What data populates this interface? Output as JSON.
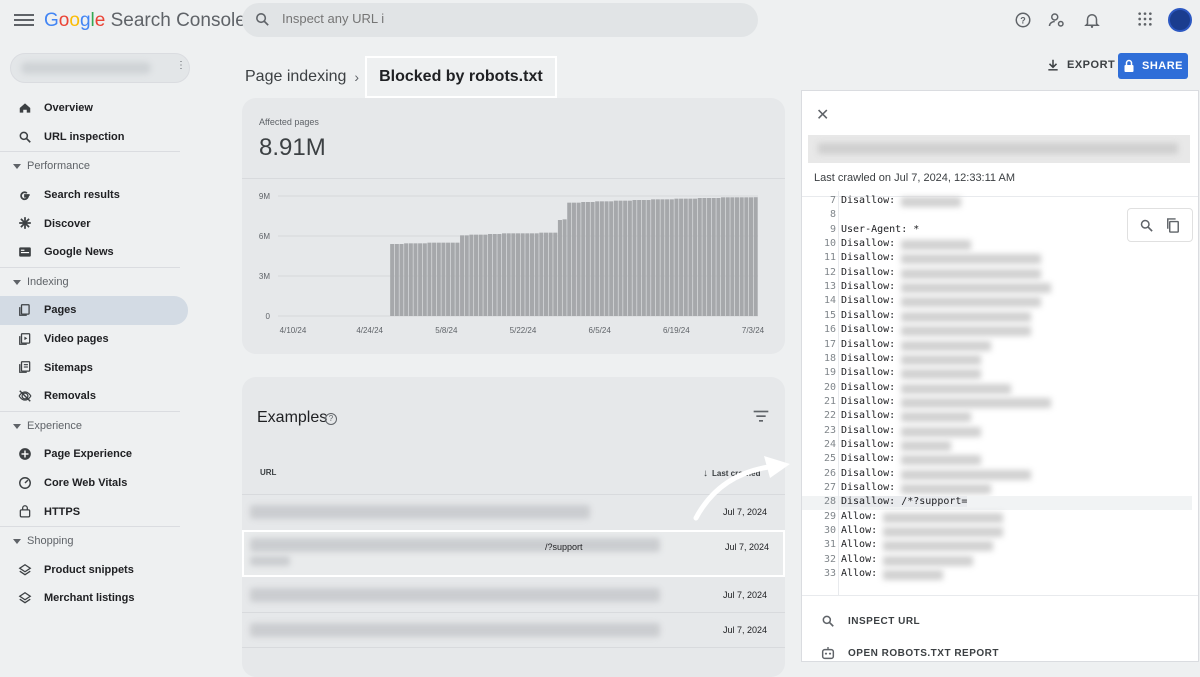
{
  "app": {
    "title": "Google Search Console",
    "logo_google": "Google",
    "logo_suffix": "Search Console"
  },
  "search": {
    "placeholder": "Inspect any URL i"
  },
  "breadcrumb": {
    "parent": "Page indexing",
    "current": "Blocked by robots.txt"
  },
  "toolbar": {
    "export_label": "EXPORT",
    "share_label": "SHARE"
  },
  "sidebar": {
    "top": [
      {
        "label": "Overview",
        "icon": "home-icon"
      },
      {
        "label": "URL inspection",
        "icon": "search-icon"
      }
    ],
    "sections": [
      {
        "title": "Performance",
        "items": [
          {
            "label": "Search results",
            "icon": "google-g-icon"
          },
          {
            "label": "Discover",
            "icon": "asterisk-icon"
          },
          {
            "label": "Google News",
            "icon": "news-icon"
          }
        ]
      },
      {
        "title": "Indexing",
        "items": [
          {
            "label": "Pages",
            "icon": "pages-icon",
            "active": true
          },
          {
            "label": "Video pages",
            "icon": "video-pages-icon"
          },
          {
            "label": "Sitemaps",
            "icon": "sitemap-icon"
          },
          {
            "label": "Removals",
            "icon": "removals-icon"
          }
        ]
      },
      {
        "title": "Experience",
        "items": [
          {
            "label": "Page Experience",
            "icon": "plus-circle-icon"
          },
          {
            "label": "Core Web Vitals",
            "icon": "gauge-icon"
          },
          {
            "label": "HTTPS",
            "icon": "lock-icon"
          }
        ]
      },
      {
        "title": "Shopping",
        "items": [
          {
            "label": "Product snippets",
            "icon": "layers-icon"
          },
          {
            "label": "Merchant listings",
            "icon": "layers-icon"
          }
        ]
      }
    ]
  },
  "summary": {
    "affected_label": "Affected pages",
    "affected_value": "8.91M"
  },
  "chart_data": {
    "type": "bar",
    "title": "",
    "xlabel": "",
    "ylabel": "",
    "ylim": [
      0,
      9000000
    ],
    "y_ticks": [
      "0",
      "3M",
      "6M",
      "9M"
    ],
    "x_ticks": [
      "4/10/24",
      "4/24/24",
      "5/8/24",
      "5/22/24",
      "6/5/24",
      "6/19/24",
      "7/3/24"
    ],
    "grid": true,
    "series": [
      {
        "values": [
          0,
          0,
          0,
          0,
          0,
          0,
          0,
          0,
          0,
          0,
          0,
          0,
          0,
          0,
          0,
          0,
          0,
          0,
          0,
          0,
          0,
          0,
          0,
          0,
          5400000,
          5400000,
          5400000,
          5450000,
          5450000,
          5450000,
          5450000,
          5450000,
          5500000,
          5500000,
          5500000,
          5500000,
          5500000,
          5500000,
          5500000,
          6050000,
          6050000,
          6100000,
          6100000,
          6100000,
          6100000,
          6150000,
          6150000,
          6150000,
          6200000,
          6200000,
          6200000,
          6200000,
          6200000,
          6200000,
          6200000,
          6200000,
          6250000,
          6250000,
          6250000,
          6250000,
          7200000,
          7250000,
          8500000,
          8500000,
          8500000,
          8550000,
          8550000,
          8550000,
          8600000,
          8600000,
          8600000,
          8600000,
          8650000,
          8650000,
          8650000,
          8650000,
          8700000,
          8700000,
          8700000,
          8700000,
          8750000,
          8750000,
          8750000,
          8750000,
          8750000,
          8800000,
          8800000,
          8800000,
          8800000,
          8800000,
          8850000,
          8850000,
          8850000,
          8850000,
          8850000,
          8900000,
          8900000,
          8900000,
          8900000,
          8900000,
          8900000,
          8900000,
          8910000
        ]
      }
    ]
  },
  "examples": {
    "title": "Examples",
    "col_url": "URL",
    "col_last": "Last crawled",
    "rows": [
      {
        "date": "Jul 7, 2024",
        "url_fragment": ""
      },
      {
        "date": "Jul 7, 2024",
        "url_fragment": "/?support"
      },
      {
        "date": "Jul 7, 2024",
        "url_fragment": ""
      },
      {
        "date": "Jul 7, 2024",
        "url_fragment": ""
      }
    ]
  },
  "panel": {
    "last_crawled": "Last crawled on Jul 7, 2024, 12:33:11 AM",
    "lines": [
      {
        "n": "7",
        "t": "Disallow:"
      },
      {
        "n": "8",
        "t": ""
      },
      {
        "n": "9",
        "t": "User-Agent: *"
      },
      {
        "n": "10",
        "t": "Disallow:"
      },
      {
        "n": "11",
        "t": "Disallow:"
      },
      {
        "n": "12",
        "t": "Disallow:"
      },
      {
        "n": "13",
        "t": "Disallow:"
      },
      {
        "n": "14",
        "t": "Disallow:"
      },
      {
        "n": "15",
        "t": "Disallow:"
      },
      {
        "n": "16",
        "t": "Disallow:"
      },
      {
        "n": "17",
        "t": "Disallow:"
      },
      {
        "n": "18",
        "t": "Disallow:"
      },
      {
        "n": "19",
        "t": "Disallow:"
      },
      {
        "n": "20",
        "t": "Disallow:"
      },
      {
        "n": "21",
        "t": "Disallow:"
      },
      {
        "n": "22",
        "t": "Disallow:"
      },
      {
        "n": "23",
        "t": "Disallow:"
      },
      {
        "n": "24",
        "t": "Disallow:"
      },
      {
        "n": "25",
        "t": "Disallow:"
      },
      {
        "n": "26",
        "t": "Disallow:"
      },
      {
        "n": "27",
        "t": "Disallow:"
      },
      {
        "n": "28",
        "t": "Disallow: /*?support="
      },
      {
        "n": "29",
        "t": "Allow:"
      },
      {
        "n": "30",
        "t": "Allow:"
      },
      {
        "n": "31",
        "t": "Allow:"
      },
      {
        "n": "32",
        "t": "Allow:"
      },
      {
        "n": "33",
        "t": "Allow:"
      }
    ],
    "inspect_url": "INSPECT URL",
    "open_report": "OPEN ROBOTS.TXT REPORT"
  }
}
